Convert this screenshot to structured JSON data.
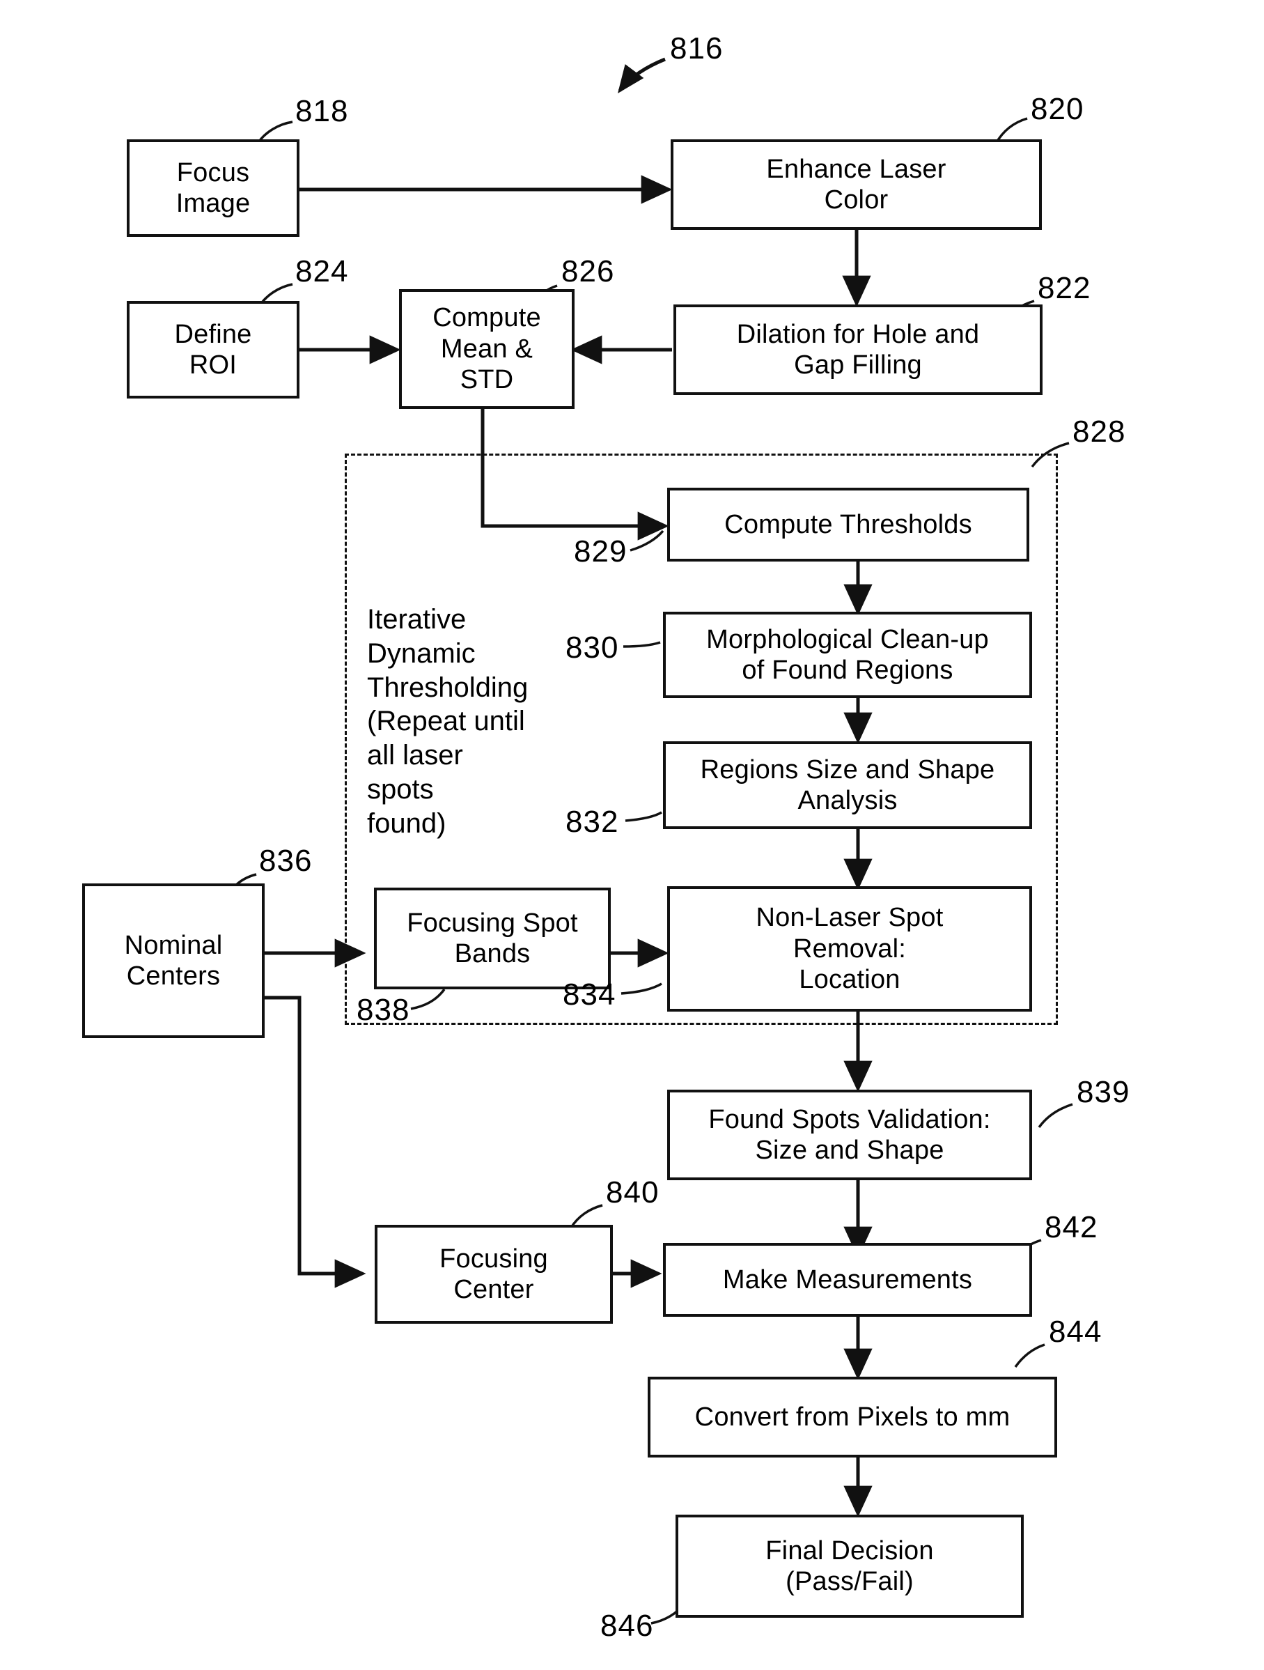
{
  "figure": {
    "main_ref": "816",
    "title_ref_note": "Laser spot focus inspection flowchart"
  },
  "nodes": [
    {
      "id": "focus_image",
      "label": "Focus\nImage",
      "ref": "818"
    },
    {
      "id": "enhance_laser",
      "label": "Enhance Laser\nColor",
      "ref": "820"
    },
    {
      "id": "define_roi",
      "label": "Define\nROI",
      "ref": "824"
    },
    {
      "id": "compute_mean_std",
      "label": "Compute\nMean &\nSTD",
      "ref": "826"
    },
    {
      "id": "dilation",
      "label": "Dilation for Hole and\nGap Filling",
      "ref": "822"
    },
    {
      "id": "compute_thresh",
      "label": "Compute Thresholds",
      "ref": "829"
    },
    {
      "id": "morph_cleanup",
      "label": "Morphological Clean-up\nof Found Regions",
      "ref": "830"
    },
    {
      "id": "regions_analysis",
      "label": "Regions Size and Shape\nAnalysis",
      "ref": "832"
    },
    {
      "id": "focusing_bands",
      "label": "Focusing Spot\nBands",
      "ref": "838"
    },
    {
      "id": "nonlaser_removal",
      "label": "Non-Laser Spot\nRemoval:\nLocation",
      "ref": "834"
    },
    {
      "id": "nominal_centers",
      "label": "Nominal\nCenters",
      "ref": "836"
    },
    {
      "id": "found_validation",
      "label": "Found Spots Validation:\nSize and Shape",
      "ref": "839"
    },
    {
      "id": "focusing_center",
      "label": "Focusing\nCenter",
      "ref": "840"
    },
    {
      "id": "make_measure",
      "label": "Make Measurements",
      "ref": "842"
    },
    {
      "id": "convert_px_mm",
      "label": "Convert from Pixels to mm",
      "ref": "844"
    },
    {
      "id": "final_decision",
      "label": "Final Decision\n(Pass/Fail)",
      "ref": "846"
    }
  ],
  "groups": [
    {
      "id": "iterative_group",
      "ref": "828",
      "caption": "Iterative\nDynamic\nThresholding\n(Repeat until\nall laser\nspots\nfound)"
    }
  ],
  "refs": {
    "r816": "816",
    "r818": "818",
    "r820": "820",
    "r822": "822",
    "r824": "824",
    "r826": "826",
    "r828": "828",
    "r829": "829",
    "r830": "830",
    "r832": "832",
    "r834": "834",
    "r836": "836",
    "r838": "838",
    "r839": "839",
    "r840": "840",
    "r842": "842",
    "r844": "844",
    "r846": "846"
  },
  "colors": {
    "ink": "#111111",
    "paper": "#ffffff"
  }
}
